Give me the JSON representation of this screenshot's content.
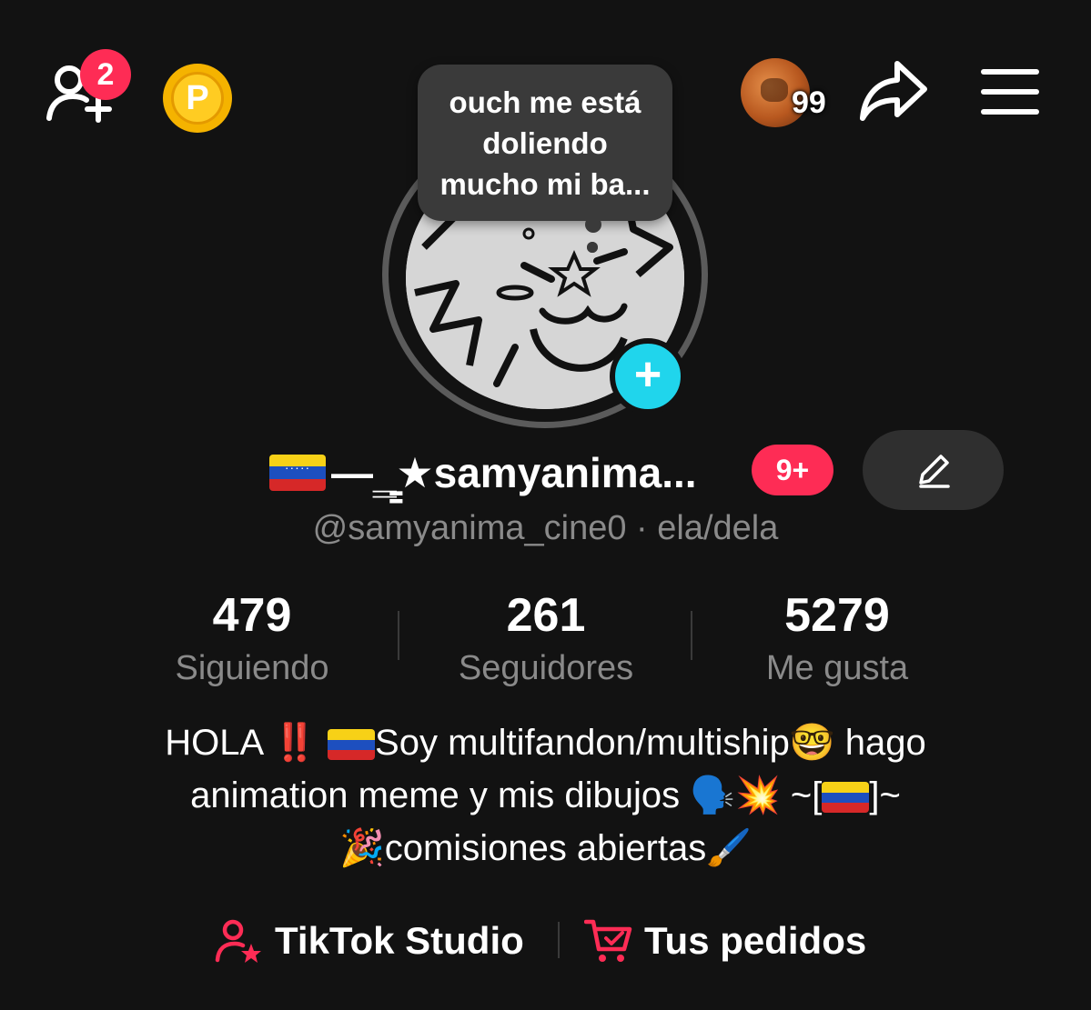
{
  "header": {
    "add_friends_badge": "2",
    "coin_label": "P",
    "viewers_count": "99",
    "share_icon": "share-arrow-icon",
    "menu_icon": "hamburger-menu-icon"
  },
  "profile": {
    "note": "ouch me está doliendo mucho mi ba...",
    "display_name": "—‗̳★samyanima...",
    "name_badge": "9+",
    "handle": "@samyanima_cine0 · ela/dela"
  },
  "stats": [
    {
      "value": "479",
      "label": "Siguiendo"
    },
    {
      "value": "261",
      "label": "Seguidores"
    },
    {
      "value": "5279",
      "label": "Me gusta"
    }
  ],
  "bio": {
    "line1_prefix": "HOLA ‼️ ",
    "line1_main": "Soy multifandon/multiship🤓 hago",
    "line2_main": "animation meme y mis dibujos 🗣️💥 ~[",
    "line2_end": "]~",
    "line3": "🎉comisiones abiertas🖌️"
  },
  "links": {
    "studio": "TikTok Studio",
    "orders": "Tus pedidos"
  },
  "colors": {
    "background": "#121212",
    "accent_red": "#fe2c55",
    "accent_cyan": "#20d5ec",
    "muted_text": "#8a8a8a"
  }
}
